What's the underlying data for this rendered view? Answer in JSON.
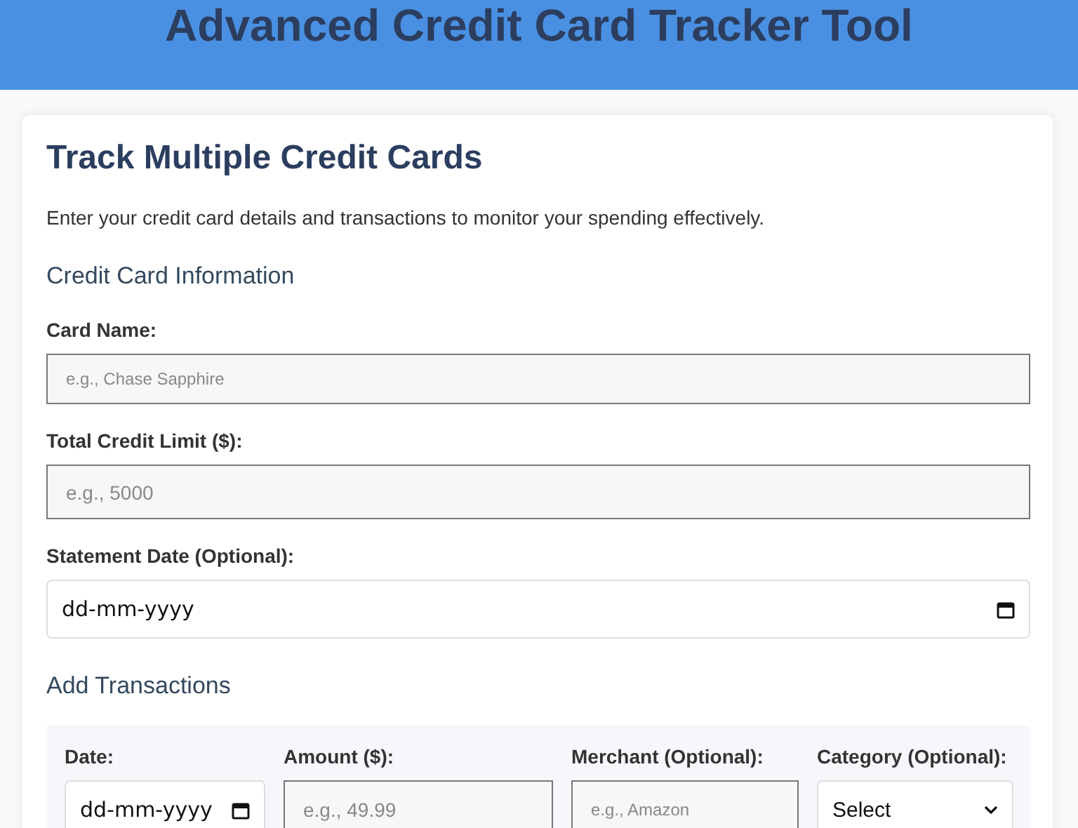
{
  "header": {
    "title": "Advanced Credit Card Tracker Tool"
  },
  "card": {
    "title": "Track Multiple Credit Cards",
    "intro": "Enter your credit card details and transactions to monitor your spending effectively.",
    "card_section": {
      "heading": "Credit Card Information",
      "fields": [
        {
          "label": "Card Name:",
          "kind": "compact",
          "placeholder": "e.g., Chase Sapphire"
        },
        {
          "label": "Total Credit Limit ($):",
          "kind": "text",
          "placeholder": "e.g., 5000"
        },
        {
          "label": "Statement Date (Optional):",
          "kind": "date",
          "placeholder": "dd-mm-yyyy"
        }
      ]
    },
    "transactions": {
      "heading": "Add Transactions",
      "fields": [
        {
          "label": "Date:",
          "kind": "date",
          "placeholder": "dd-mm-yyyy"
        },
        {
          "label": "Amount ($):",
          "kind": "text",
          "placeholder": "e.g., 49.99"
        },
        {
          "label": "Merchant (Optional):",
          "kind": "compact",
          "placeholder": "e.g., Amazon"
        },
        {
          "label": "Category (Optional):",
          "kind": "select",
          "value": "Select"
        }
      ]
    }
  }
}
